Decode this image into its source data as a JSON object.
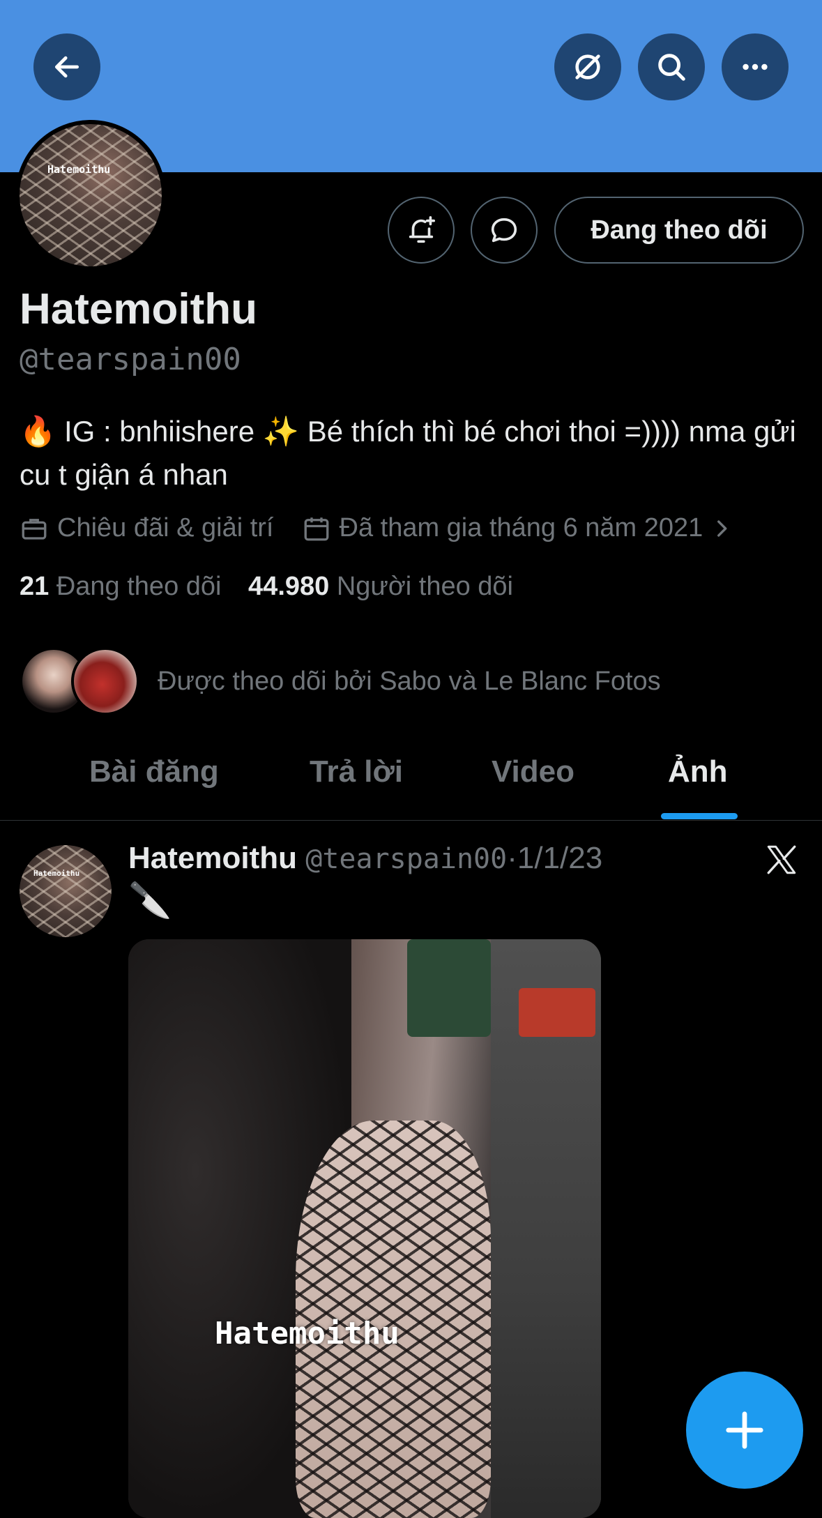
{
  "profile": {
    "name": "Hatemoithu",
    "handle": "@tearspain00",
    "avatar_watermark": "Hatemoithu",
    "bio": "🔥 IG : bnhiishere ✨ Bé thích thì bé chơi thoi =)))) nma gửi cu t giận á nhan",
    "category": "Chiêu đãi & giải trí",
    "joined": "Đã tham gia tháng 6 năm 2021",
    "following_count": "21",
    "following_label": "Đang theo dõi",
    "followers_count": "44.980",
    "followers_label": "Người theo dõi",
    "followed_by": "Được theo dõi bởi Sabo và Le Blanc Fotos"
  },
  "actions": {
    "follow_button": "Đang theo dõi"
  },
  "tabs": [
    {
      "label": "Bài đăng",
      "active": false
    },
    {
      "label": "Trả lời",
      "active": false
    },
    {
      "label": "Video",
      "active": false
    },
    {
      "label": "Ảnh",
      "active": true
    }
  ],
  "post": {
    "author": "Hatemoithu",
    "handle": "@tearspain00",
    "separator": "·",
    "date": "1/1/23",
    "text": "🔪",
    "image_watermark": "Hatemoithu"
  },
  "colors": {
    "banner": "#4a90e2",
    "accent": "#1d9bf0",
    "background": "#000000",
    "muted_text": "#71767b"
  }
}
